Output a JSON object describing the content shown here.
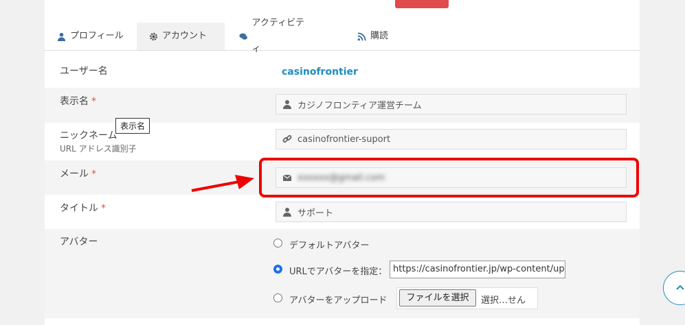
{
  "tabs": [
    {
      "label": "プロフィール",
      "icon": "user-icon"
    },
    {
      "label": "アカウント",
      "icon": "gear-icon"
    },
    {
      "label": "アクティビティ",
      "icon": "comments-icon"
    },
    {
      "label": "購読",
      "icon": "rss-icon"
    }
  ],
  "fields": {
    "username": {
      "label": "ユーザー名",
      "value": "casinofrontier"
    },
    "display_name": {
      "label": "表示名",
      "required": "*",
      "value": "カジノフロンティア運営チーム",
      "tooltip": "表示名"
    },
    "nickname": {
      "label": "ニックネーム",
      "sub_label": "URL アドレス識別子",
      "value": "casinofrontier-suport"
    },
    "email": {
      "label": "メール",
      "required": "*",
      "value": "xxxxxx@gmail.com"
    },
    "title": {
      "label": "タイトル",
      "required": "*",
      "value": "サポート"
    },
    "avatar": {
      "label": "アバター",
      "options": [
        {
          "label": "デフォルトアバター",
          "checked": false
        },
        {
          "label": "URLでアバターを指定：",
          "checked": true
        },
        {
          "label": "アバターをアップロード",
          "checked": false
        }
      ],
      "url_value": "https://casinofrontier.jp/wp-content/uplo",
      "file_button": "ファイルを選択",
      "file_status": "選択…せん"
    }
  },
  "colors": {
    "accent": "#1e8cbe",
    "highlight": "#e00000",
    "required": "#d9534f"
  }
}
